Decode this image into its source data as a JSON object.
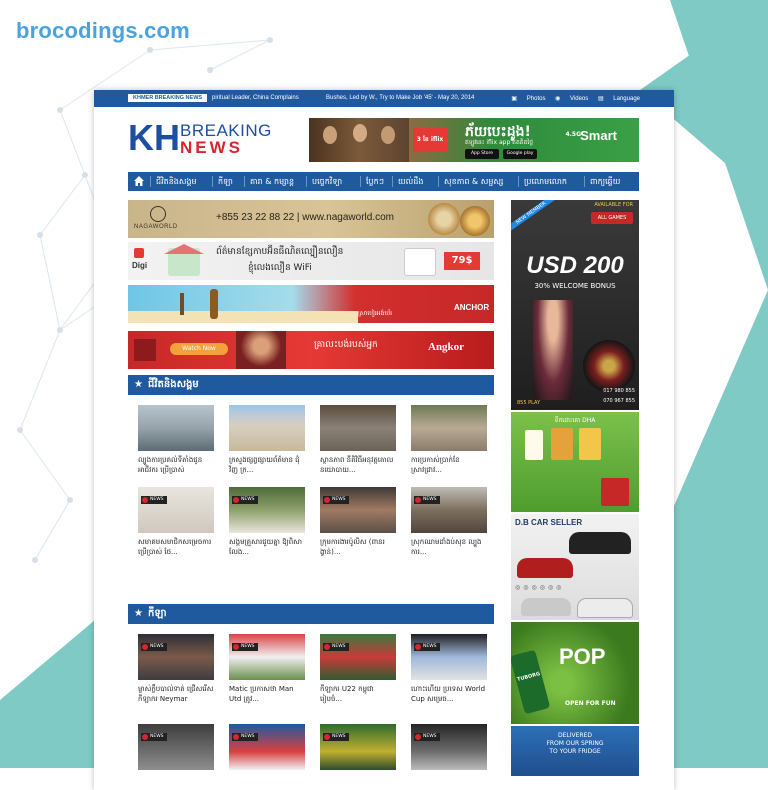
{
  "site": {
    "name": "brocodings.com"
  },
  "topbar": {
    "breaking_label": "KHMER BREAKING NEWS",
    "ticker1": "piritual Leader, China Complains",
    "ticker2": "Bushes, Led by W., Try to Make Job '45' - May 20, 2014",
    "photos": "Photos",
    "videos": "Videos",
    "language": "Language"
  },
  "logo": {
    "kh": "KH",
    "breaking": "BREAKING",
    "news": "NEWS"
  },
  "header_ad": {
    "title": "ភ័យបេះដូង!",
    "subtitle": "ឥឡូវនេះ iflix app ឥតគិតថ្លៃ",
    "badge": "3 ខែ iflix",
    "app_store": "App Store",
    "google_play": "Google play",
    "brand": "Smart",
    "network": "4.5G"
  },
  "nav": {
    "items": [
      "ជីវិតនិងសង្គម",
      "កីឡា",
      "តារា & កម្សាន្ត",
      "បច្ចេកវិទ្យា",
      "ប្លែកៗ",
      "យល់ដឹង",
      "សុខភាព & សម្ផស្ស",
      "ប្រលោមលោក",
      "ពាក្យឆ្លើយ"
    ]
  },
  "banners": [
    {
      "brand": "NAGAWORLD",
      "text": "+855 23 22 88 22  |  www.nagaworld.com"
    },
    {
      "brand": "Digi",
      "text": "ព័ត៌មានខ្សែកាបអ៊ីនធឺណិតល្បឿនលឿន",
      "text2": "ខ្ញុំលេងលឿន WiFi",
      "price": "79$"
    },
    {
      "brand": "ANCHOR",
      "text": "ស្រាបៀរអង់ឃ័រ"
    },
    {
      "brand": "Angkor",
      "text": "គ្រាលះបង់របស់អ្នក",
      "watch": "Watch Now"
    }
  ],
  "sections": [
    {
      "title": "ជីវិតនិងសង្គម",
      "items": [
        {
          "caption": "ល្បួងការប្រគល់ទីតាំងជូនអាជីវករ ប្រើប្រាស់",
          "badge": ""
        },
        {
          "caption": "ក្រសួងផ្សព្វផ្សាយព័ត៌មាន ជុំវិញ ក្រ...",
          "badge": ""
        },
        {
          "caption": "ស្ថានភាព នីតិវិធីអនុវត្តគោលនយោបាយ...",
          "badge": ""
        },
        {
          "caption": "ការប្រកាស់ប្រាក់ខែស្រាវជ្រាវ...",
          "badge": ""
        },
        {
          "caption": "សមាគមសមាជិកសម្រេចការ ប្រើប្រាស់ ថែ...",
          "badge": "NEWS"
        },
        {
          "caption": "សង្គមគ្រួសារជួយគ្នា ឱ្យពិសាលែង...",
          "badge": "NEWS"
        },
        {
          "caption": "ក្រុមការងារប៉ូលិស (ពានរង្វាន់)...",
          "badge": "NEWS"
        },
        {
          "caption": "ស្រុកឈាមដាំងប់សុខ ល្បួងការ...",
          "badge": "NEWS"
        }
      ]
    },
    {
      "title": "កីឡា",
      "items": [
        {
          "caption": "ម្ចាស់ក្លឹបបាល់ទាត់ ជ្រើសរើសកីឡាករ Neymar",
          "badge": "NEWS"
        },
        {
          "caption": "Matic ប្រកាសថា Man Utd ត្រូវ...",
          "badge": "NEWS"
        },
        {
          "caption": "កីឡាករ U22 កម្ពុជា រៀបចំ...",
          "badge": "NEWS"
        },
        {
          "caption": "ហោះហើយ ប្រទេស World Cup សម្រេច...",
          "badge": "NEWS"
        },
        {
          "caption": "",
          "badge": "NEWS"
        },
        {
          "caption": "",
          "badge": "NEWS"
        },
        {
          "caption": "",
          "badge": "NEWS"
        },
        {
          "caption": "",
          "badge": "NEWS"
        }
      ]
    }
  ],
  "sidebar": {
    "casino": {
      "ribbon": "NEW MEMBER",
      "tagline": "AVAILABLE FOR",
      "button": "ALL GAMES",
      "amount": "USD 200",
      "bonus": "30% WELCOME BONUS",
      "phone1": "017 980 855",
      "phone2": "070 967 855",
      "brand": "855 PLAY"
    },
    "dha": {
      "title": "ទឹកដោះគោ DHA"
    },
    "car": {
      "title": "D.B CAR SELLER"
    },
    "tuborg": {
      "brand": "TUBORG",
      "big": "POP",
      "sub": "OPEN FOR FUN"
    },
    "delivery": {
      "line1": "DELIVERED",
      "line2": "FROM OUR SPRING",
      "line3": "TO YOUR FRIDGE"
    }
  },
  "colors": {
    "brand_blue": "#1f5a9e",
    "accent_red": "#d6262f",
    "teal_bg": "#7fcac5",
    "site_logo": "#4aa3df"
  }
}
